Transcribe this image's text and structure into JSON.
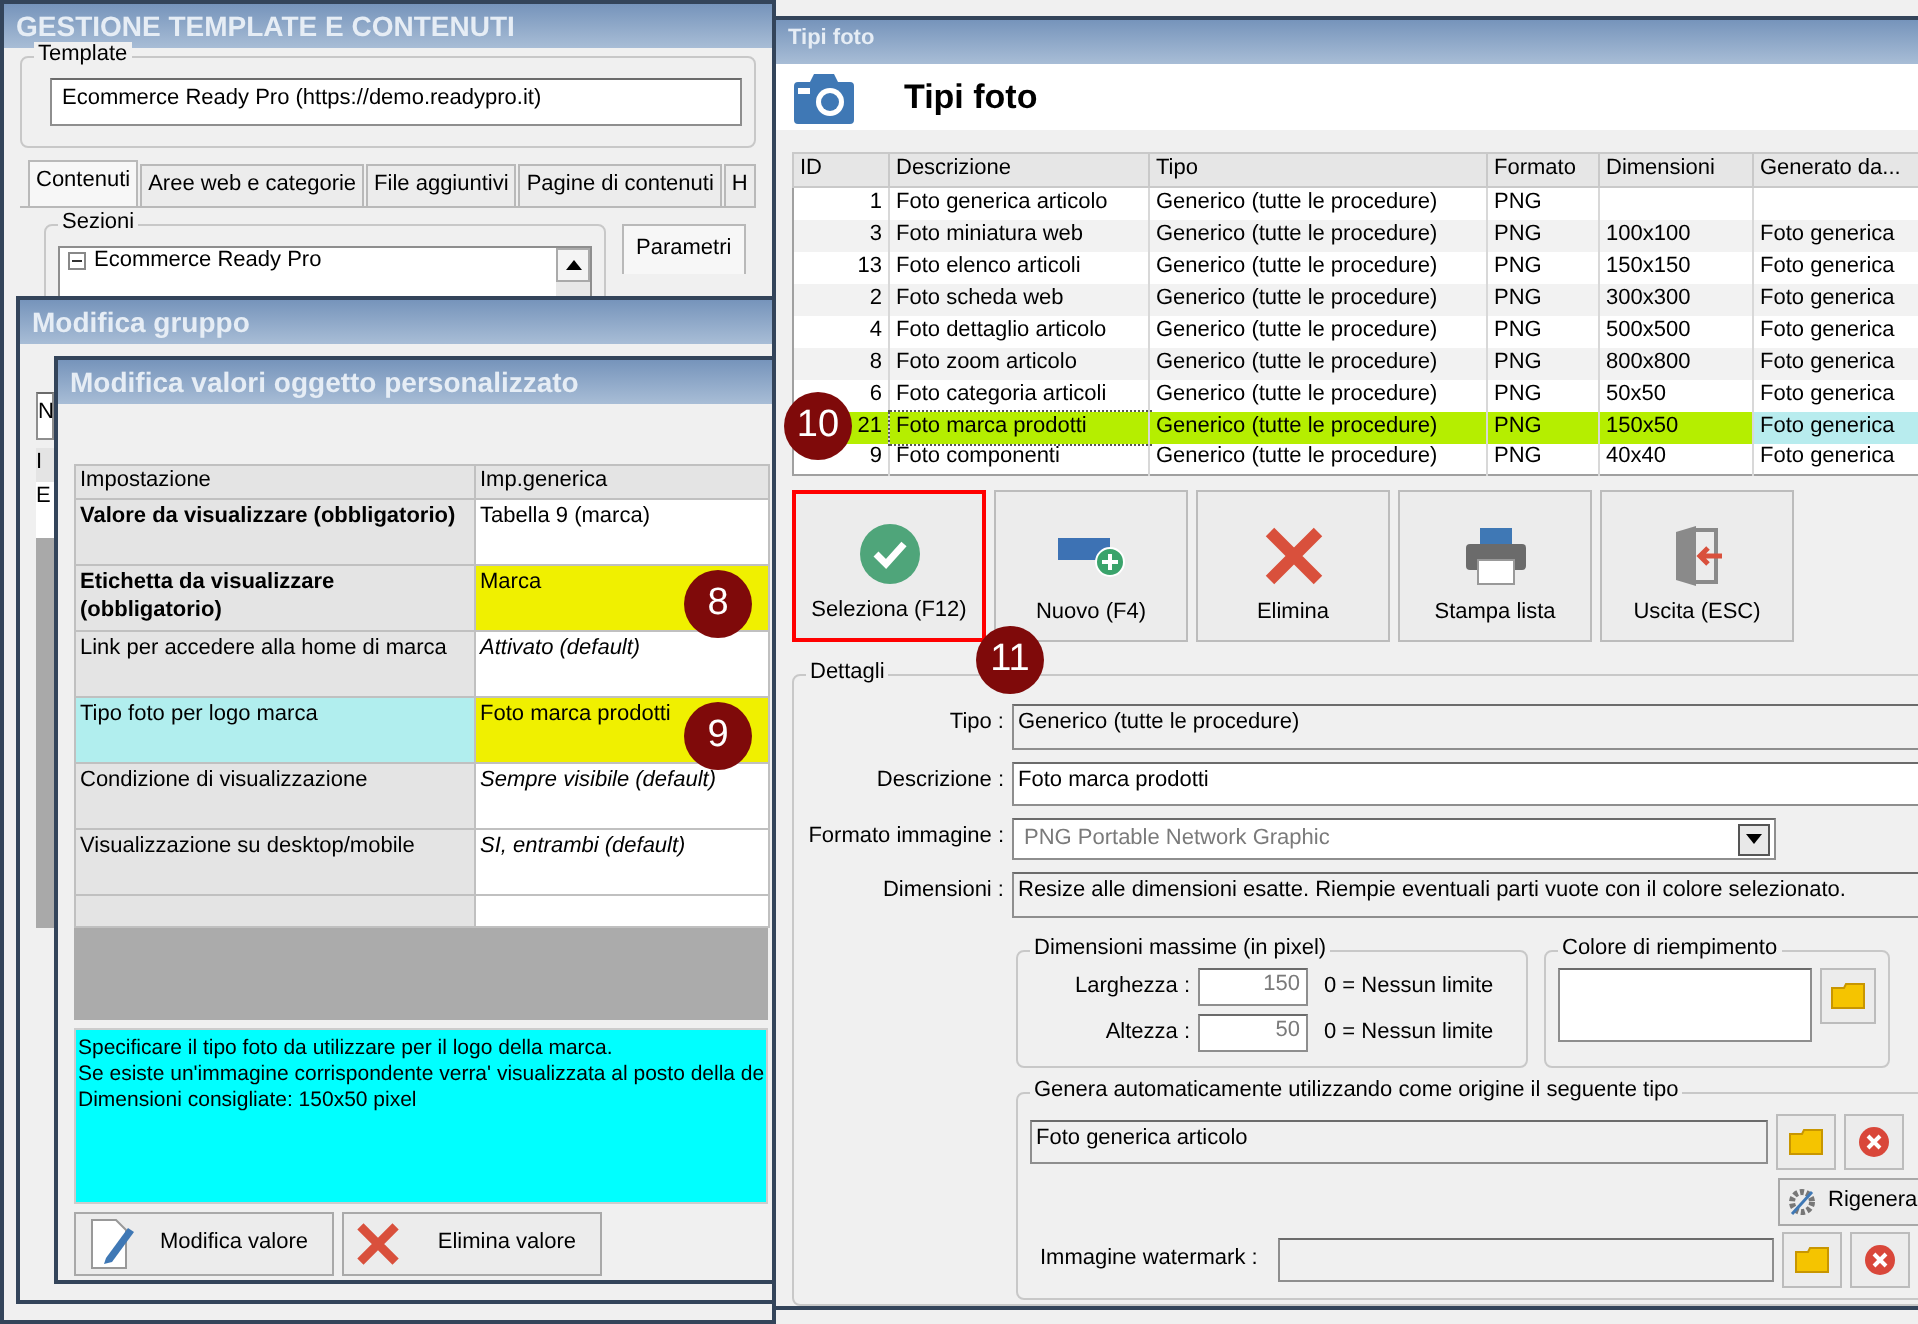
{
  "main_window": {
    "title": "GESTIONE TEMPLATE E CONTENUTI",
    "template": {
      "label": "Template",
      "value": "Ecommerce Ready Pro (https://demo.readypro.it)"
    },
    "tabs": [
      {
        "label": "Contenuti",
        "selected": true
      },
      {
        "label": "Aree web e categorie",
        "selected": false
      },
      {
        "label": "File aggiuntivi",
        "selected": false
      },
      {
        "label": "Pagine di contenuti",
        "selected": false
      },
      {
        "label": "H",
        "selected": false
      }
    ],
    "sections": {
      "label": "Sezioni",
      "tree": [
        {
          "label": "Ecommerce Ready Pro",
          "expanded": true
        }
      ]
    },
    "side_tab": "Parametri"
  },
  "group_window": {
    "title": "Modifica gruppo",
    "field_value": "N",
    "grid_header": "I",
    "grid_cell": "E"
  },
  "values_window": {
    "title": "Modifica valori oggetto personalizzato",
    "columns": [
      "Impostazione",
      "Imp.generica"
    ],
    "rows": [
      {
        "setting": "Valore da visualizzare (obbligatorio)",
        "value": "Tabella 9 (marca)",
        "required": true,
        "is_default": false,
        "selected": false,
        "highlighted": false
      },
      {
        "setting": "Etichetta da visualizzare (obbligatorio)",
        "value": "Marca",
        "required": true,
        "is_default": false,
        "selected": false,
        "highlighted": true,
        "badge": "8"
      },
      {
        "setting": "Link per accedere alla home di marca",
        "value": "Attivato (default)",
        "required": false,
        "is_default": true,
        "selected": false,
        "highlighted": false
      },
      {
        "setting": "Tipo foto per logo marca",
        "value": "Foto marca prodotti",
        "required": false,
        "is_default": false,
        "selected": true,
        "highlighted": true,
        "badge": "9"
      },
      {
        "setting": "Condizione di visualizzazione",
        "value": "Sempre visibile (default)",
        "required": false,
        "is_default": true,
        "selected": false,
        "highlighted": false
      },
      {
        "setting": "Visualizzazione su desktop/mobile",
        "value": "SI, entrambi (default)",
        "required": false,
        "is_default": true,
        "selected": false,
        "highlighted": false
      }
    ],
    "help_lines": [
      "Specificare il tipo foto da utilizzare per il logo della marca.",
      "Se esiste un'immagine corrispondente verra' visualizzata al posto della de",
      "Dimensioni consigliate: 150x50 pixel"
    ],
    "buttons": [
      {
        "label": "Modifica valore",
        "kind": "edit"
      },
      {
        "label": "Elimina valore",
        "kind": "delete"
      }
    ]
  },
  "photo_window": {
    "title": "Tipi foto",
    "heading": "Tipi foto",
    "columns": [
      "ID",
      "Descrizione",
      "Tipo",
      "Formato",
      "Dimensioni",
      "Generato da..."
    ],
    "rows": [
      {
        "id": "1",
        "description": "Foto generica articolo",
        "type": "Generico (tutte le procedure)",
        "format": "PNG",
        "selected": false
      },
      {
        "id": "3",
        "description": "Foto miniatura web",
        "type": "Generico (tutte le procedure)",
        "format": "PNG",
        "dimensions": "100x100",
        "generated_from": "Foto generica",
        "selected": false
      },
      {
        "id": "13",
        "description": "Foto elenco articoli",
        "type": "Generico (tutte le procedure)",
        "format": "PNG",
        "dimensions": "150x150",
        "generated_from": "Foto generica",
        "selected": false
      },
      {
        "id": "2",
        "description": "Foto scheda web",
        "type": "Generico (tutte le procedure)",
        "format": "PNG",
        "dimensions": "300x300",
        "generated_from": "Foto generica",
        "selected": false
      },
      {
        "id": "4",
        "description": "Foto dettaglio articolo",
        "type": "Generico (tutte le procedure)",
        "format": "PNG",
        "dimensions": "500x500",
        "generated_from": "Foto generica",
        "selected": false
      },
      {
        "id": "8",
        "description": "Foto zoom articolo",
        "type": "Generico (tutte le procedure)",
        "format": "PNG",
        "dimensions": "800x800",
        "generated_from": "Foto generica",
        "selected": false
      },
      {
        "id": "6",
        "description": "Foto categoria articoli",
        "type": "Generico (tutte le procedure)",
        "format": "PNG",
        "dimensions": "50x50",
        "generated_from": "Foto generica",
        "selected": false
      },
      {
        "id": "21",
        "description": "Foto marca prodotti",
        "type": "Generico (tutte le procedure)",
        "format": "PNG",
        "dimensions": "150x50",
        "generated_from": "Foto generica",
        "selected": true,
        "badge": "10"
      },
      {
        "id": "9",
        "description": "Foto componenti",
        "type": "Generico (tutte le procedure)",
        "format": "PNG",
        "dimensions": "40x40",
        "generated_from": "Foto generica",
        "selected": false
      }
    ],
    "toolbar": [
      {
        "label": "Seleziona (F12)",
        "kind": "select",
        "selected": true,
        "badge": "11"
      },
      {
        "label": "Nuovo (F4)",
        "kind": "new",
        "selected": false
      },
      {
        "label": "Elimina",
        "kind": "delete",
        "selected": false
      },
      {
        "label": "Stampa lista",
        "kind": "print",
        "selected": false
      },
      {
        "label": "Uscita (ESC)",
        "kind": "exit",
        "selected": false
      }
    ],
    "details": {
      "title": "Dettagli",
      "fields": [
        {
          "label": "Tipo :",
          "value": "Generico (tutte le procedure)",
          "kind": "readonly"
        },
        {
          "label": "Descrizione :",
          "value": "Foto marca prodotti",
          "kind": "text"
        },
        {
          "label": "Formato immagine :",
          "value": "PNG Portable Network Graphic",
          "kind": "select",
          "disabled": true
        },
        {
          "label": "Dimensioni :",
          "value": "Resize alle dimensioni esatte. Riempie eventuali parti vuote con il colore selezionato.",
          "kind": "readonly"
        }
      ],
      "max_size": {
        "title": "Dimensioni massime (in pixel)",
        "rows": [
          {
            "label": "Larghezza :",
            "value": "150",
            "hint": "0 = Nessun limite",
            "disabled": true
          },
          {
            "label": "Altezza :",
            "value": "50",
            "hint": "0 = Nessun limite",
            "disabled": true
          }
        ]
      },
      "fill_color": {
        "title": "Colore di riempimento"
      },
      "generate": {
        "title": "Genera automaticamente utilizzando come origine il seguente tipo",
        "source": "Foto generica articolo",
        "regenerate": "Rigenera",
        "watermark_label": "Immagine watermark :"
      }
    }
  }
}
